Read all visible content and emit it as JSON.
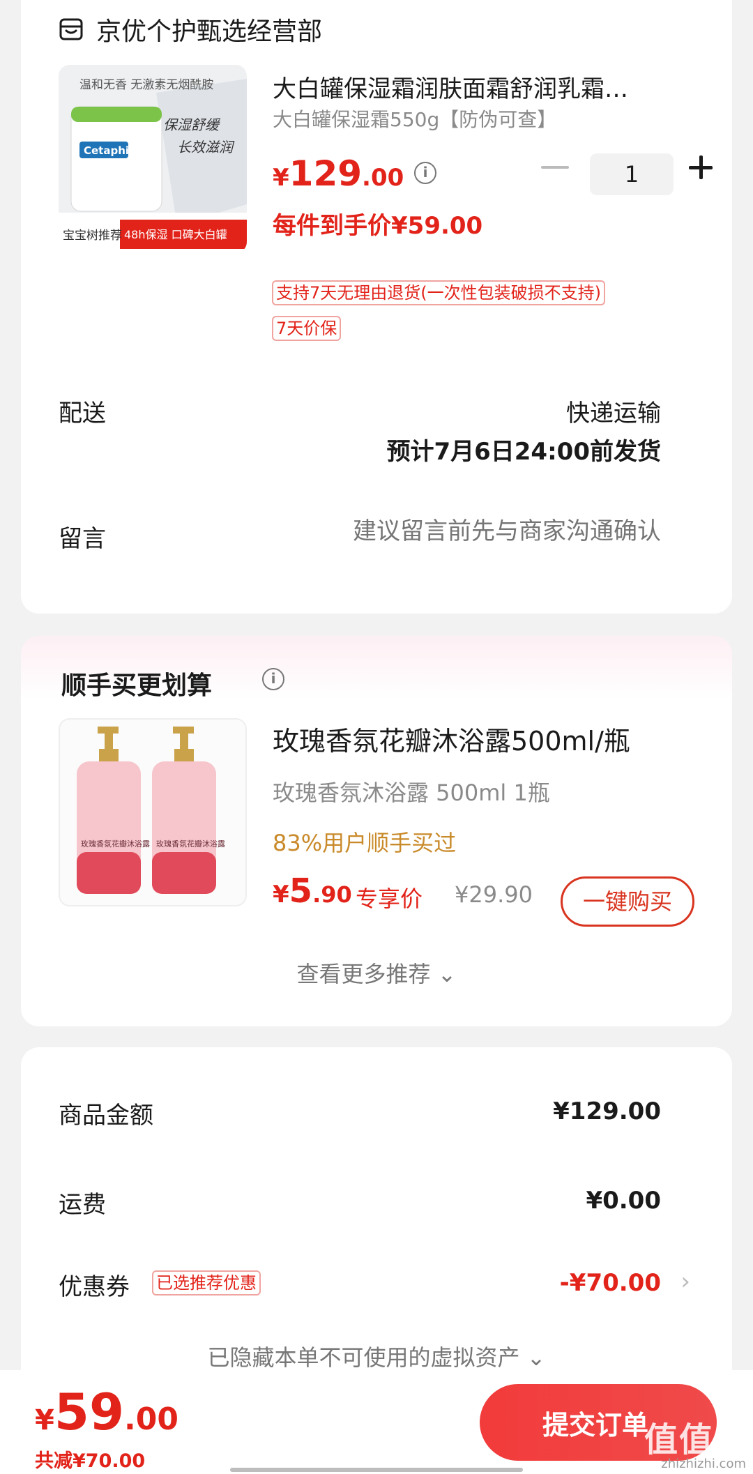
{
  "store": {
    "name": "京优个护甄选经营部",
    "icon": "store-icon"
  },
  "product": {
    "title": "大白罐保湿霜润肤面霜舒润乳霜…",
    "spec": "大白罐保湿霜550g【防伪可查】",
    "price_symbol": "¥",
    "price_int": "129",
    "price_dec": ".00",
    "final_price": "每件到手价¥59.00",
    "quantity": "1",
    "tags": [
      "支持7天无理由退货(一次性包装破损不支持)",
      "7天价保"
    ],
    "image": {
      "banner_top": "温和无香 无激素无烟酰胺",
      "brand": "Cetaphil",
      "slogan1": "保湿舒缓",
      "slogan2": "长效滋润",
      "footer_left": "宝宝树推荐",
      "footer_right": "48h保湿 口碑大白罐"
    }
  },
  "shipping": {
    "label": "配送",
    "method": "快递运输",
    "eta": "预计7月6日24:00前发货"
  },
  "message": {
    "label": "留言",
    "placeholder": "建议留言前先与商家沟通确认"
  },
  "recommend": {
    "title": "顺手买更划算",
    "name": "玫瑰香氛花瓣沐浴露500ml/瓶",
    "spec": "玫瑰香氛沐浴露 500ml 1瓶",
    "popularity": "83%用户顺手买过",
    "price_symbol": "¥",
    "price_int": "5",
    "price_dec": ".90",
    "exclusive": "专享价",
    "original": "¥29.90",
    "buy_label": "一键购买",
    "more_label": "查看更多推荐 ⌄",
    "bottle_label": "玫瑰香氛花瓣沐浴露"
  },
  "summary": {
    "goods_label": "商品金额",
    "goods_value": "¥129.00",
    "freight_label": "运费",
    "freight_value": "¥0.00",
    "coupon_label": "优惠券",
    "coupon_tag": "已选推荐优惠",
    "coupon_value": "-¥70.00",
    "hidden_note": "已隐藏本单不可使用的虚拟资产 ⌄"
  },
  "bottom": {
    "price_symbol": "¥",
    "price_int": "59",
    "price_dec": ".00",
    "saved": "共减¥70.00",
    "submit_label": "提交订单",
    "watermark": "值值值",
    "watermark_sub": "zhizhizhi.com"
  },
  "colors": {
    "accent": "#e2231a",
    "gold": "#c98a2a",
    "muted": "#8a8a8a"
  }
}
